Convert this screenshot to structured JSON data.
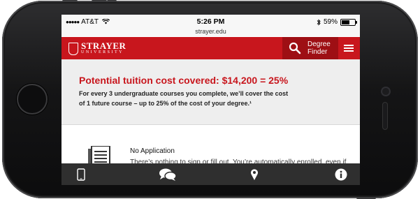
{
  "status_bar": {
    "carrier": "AT&T",
    "time": "5:26 PM",
    "battery": "59%",
    "battery_level": 0.59
  },
  "browser": {
    "url": "strayer.edu"
  },
  "header": {
    "logo_name": "STRAYER",
    "logo_sub": "UNIVERSITY",
    "degree_finder_line1": "Degree",
    "degree_finder_line2": "Finder"
  },
  "main": {
    "headline": "Potential tuition cost covered: $14,200 = 25%",
    "body_line1": "For every 3 undergraduate courses you complete, we’ll cover the cost",
    "body_line2": "of 1 future course – up to 25% of the cost of your degree.¹",
    "feature_title": "No Application",
    "feature_desc": "There’s nothing to sign or fill out. You’re automatically enrolled, even if"
  },
  "tabbar": {
    "tabs": [
      "phone-icon",
      "chat-icon",
      "location-icon",
      "info-icon"
    ]
  },
  "colors": {
    "brand_red": "#c8161d",
    "dark_red": "#9e0f14",
    "tabbar": "#2f2f2f"
  }
}
